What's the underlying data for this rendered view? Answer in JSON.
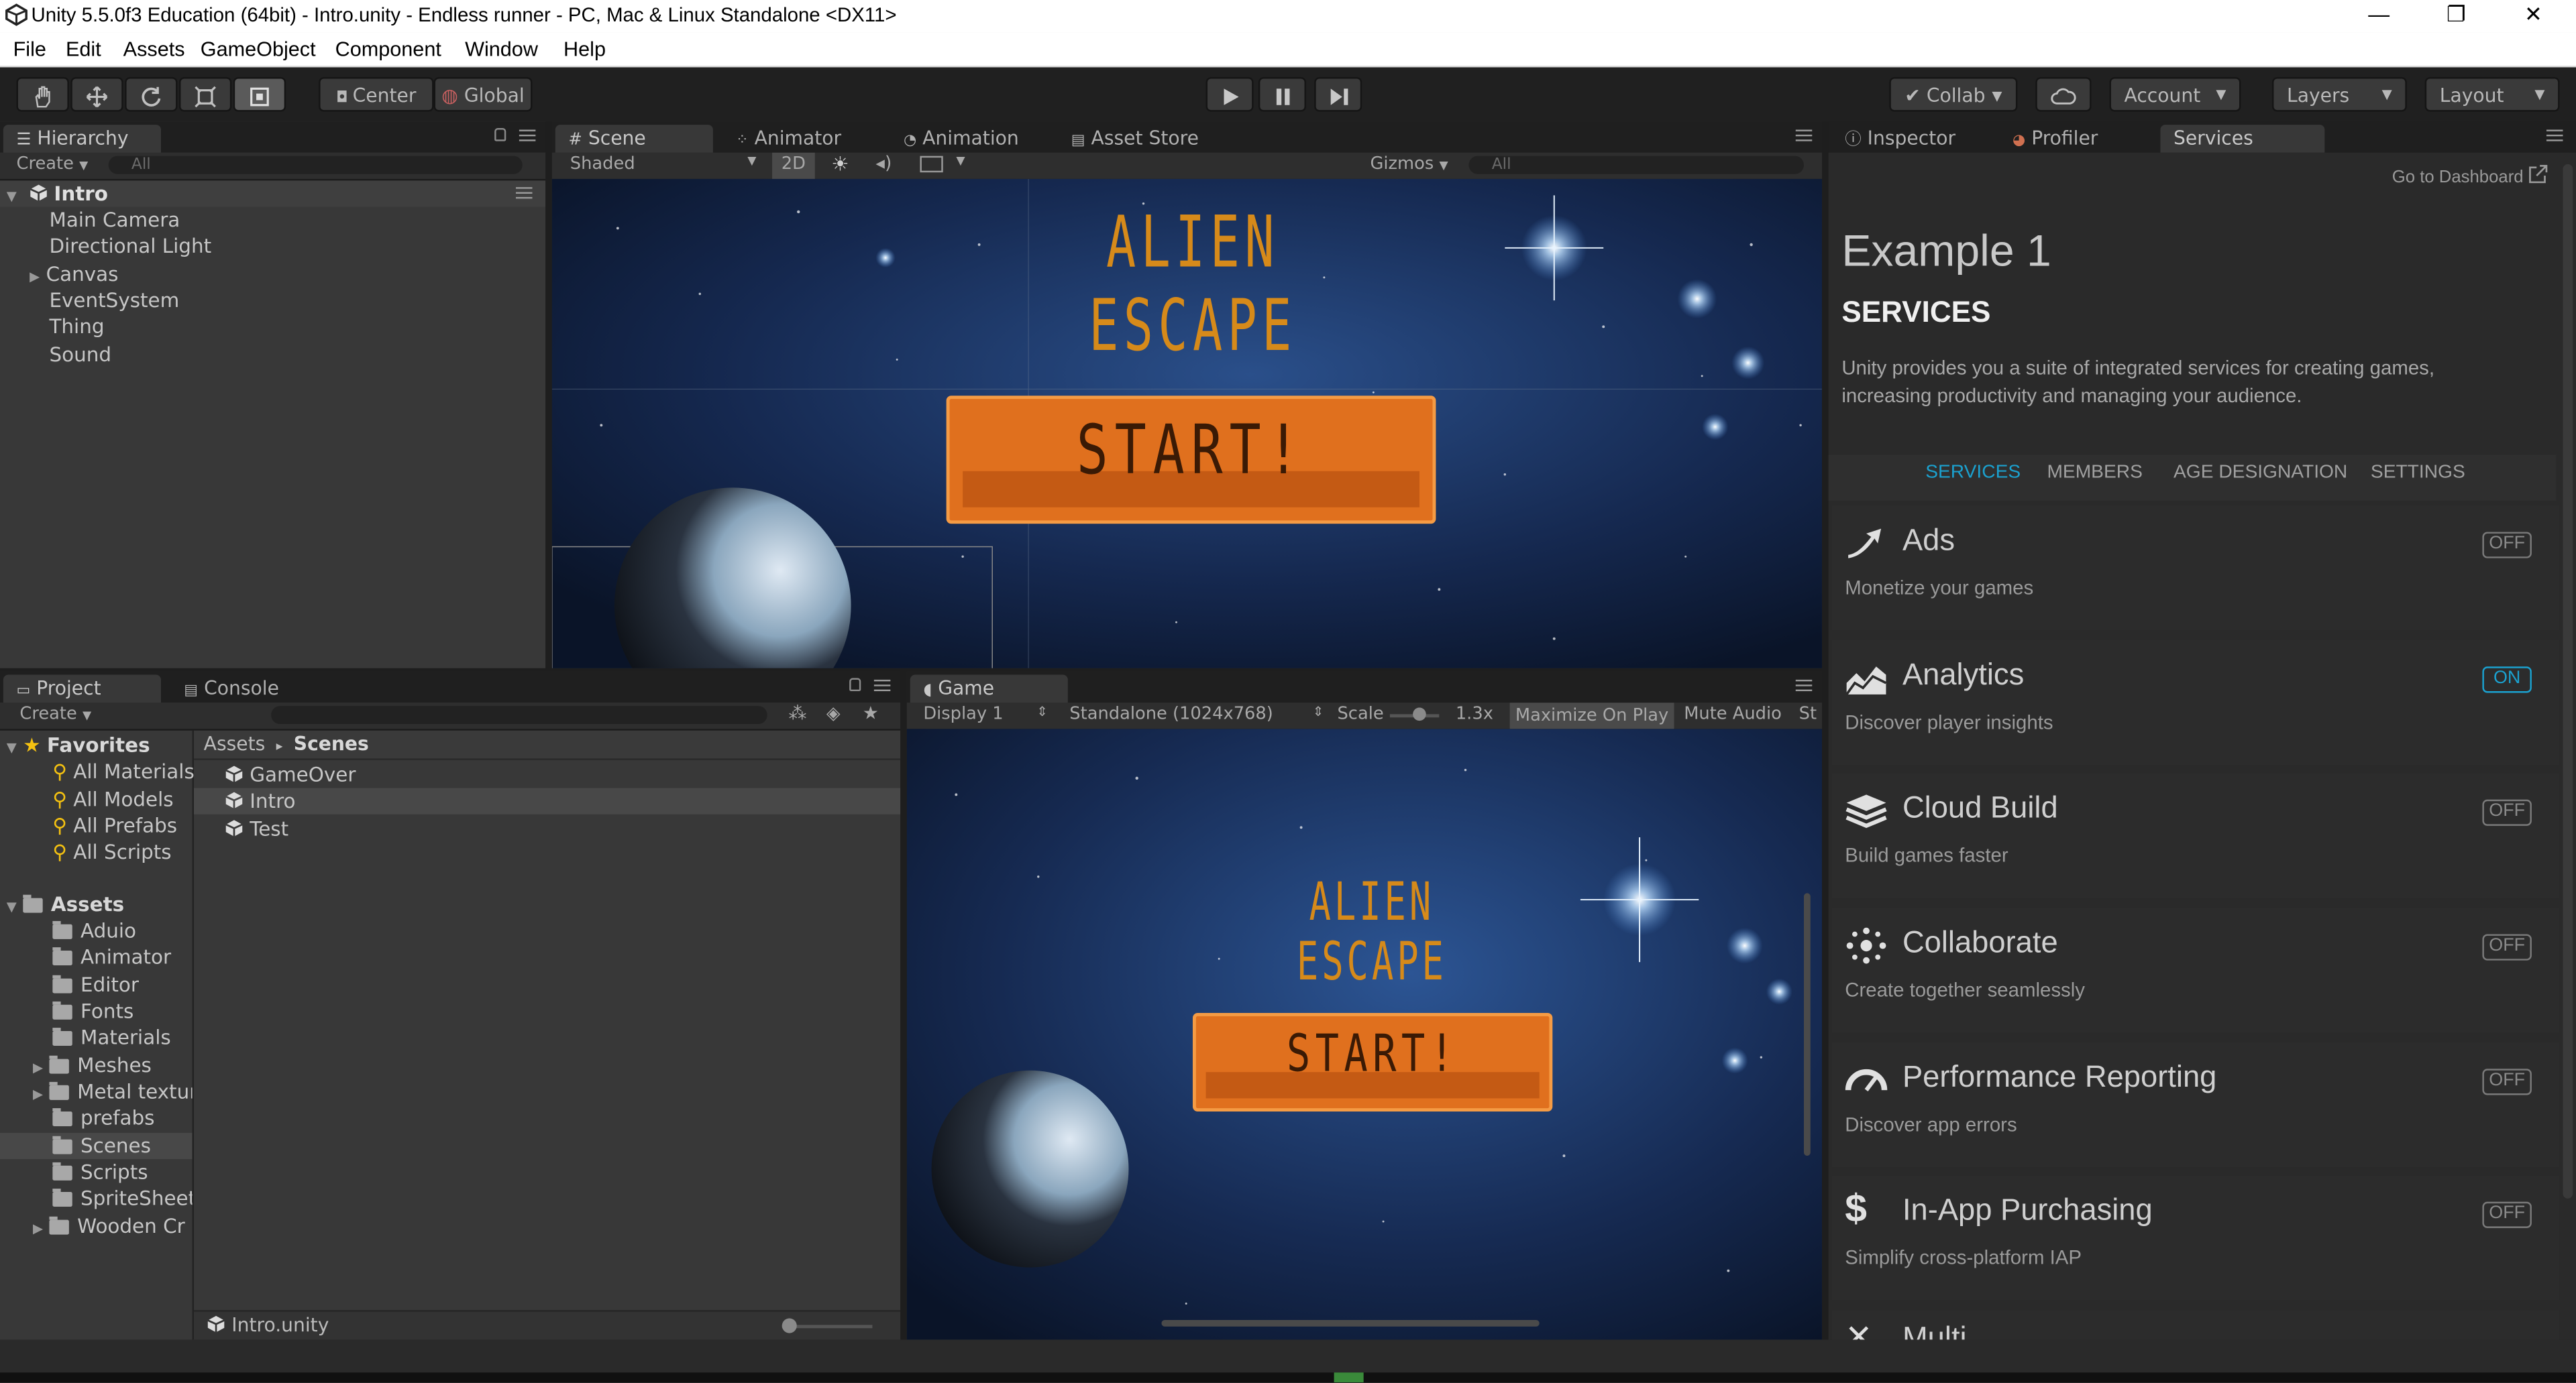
{
  "window": {
    "title": "Unity 5.5.0f3 Education (64bit) - Intro.unity - Endless runner - PC, Mac & Linux Standalone <DX11>",
    "minimize": "—",
    "restore": "❐",
    "close": "✕"
  },
  "menu": [
    "File",
    "Edit",
    "Assets",
    "GameObject",
    "Component",
    "Window",
    "Help"
  ],
  "toolbar": {
    "center_label": "Center",
    "global_label": "Global",
    "collab_label": "Collab",
    "account_label": "Account",
    "layers_label": "Layers",
    "layout_label": "Layout"
  },
  "hierarchy": {
    "tab_label": "Hierarchy",
    "create_label": "Create",
    "search_placeholder": "All",
    "scene_name": "Intro",
    "items": [
      "Main Camera",
      "Directional Light",
      "Canvas",
      "EventSystem",
      "Thing",
      "Sound"
    ]
  },
  "scene_view": {
    "tabs": [
      "Scene",
      "Animator",
      "Animation",
      "Asset Store"
    ],
    "shading": "Shaded",
    "mode_2d": "2D",
    "gizmos": "Gizmos",
    "search_placeholder": "All",
    "game_title": "ALIEN ESCAPE",
    "start_label": "START!"
  },
  "project": {
    "tabs": [
      "Project",
      "Console"
    ],
    "create_label": "Create",
    "favorites_label": "Favorites",
    "favorites": [
      "All Materials",
      "All Models",
      "All Prefabs",
      "All Scripts"
    ],
    "assets_label": "Assets",
    "folders": [
      "Aduio",
      "Animator",
      "Editor",
      "Fonts",
      "Materials",
      "Meshes",
      "Metal textur",
      "prefabs",
      "Scenes",
      "Scripts",
      "SpriteSheet",
      "Wooden Cr"
    ],
    "breadcrumb_root": "Assets",
    "breadcrumb_sep": "▸",
    "breadcrumb_current": "Scenes",
    "scene_files": [
      "GameOver",
      "Intro",
      "Test"
    ],
    "status_file": "Intro.unity"
  },
  "game_view": {
    "tab_label": "Game",
    "display": "Display 1",
    "resolution": "Standalone (1024x768)",
    "scale_label": "Scale",
    "scale_value": "1.3x",
    "maximize_label": "Maximize On Play",
    "mute_label": "Mute Audio",
    "stats_label": "St"
  },
  "services_panel": {
    "tabs": [
      "Inspector",
      "Profiler",
      "Services"
    ],
    "dashboard_link": "Go to Dashboard",
    "project_name": "Example 1",
    "heading": "SERVICES",
    "intro": "Unity provides you a suite of integrated services for creating games, increasing productivity and managing your audience.",
    "nav_tabs": [
      "SERVICES",
      "MEMBERS",
      "AGE DESIGNATION",
      "SETTINGS"
    ],
    "accent_color": "#1ba1cf",
    "services": [
      {
        "name": "Ads",
        "desc": "Monetize your games",
        "state": "OFF",
        "icon": "ads-icon"
      },
      {
        "name": "Analytics",
        "desc": "Discover player insights",
        "state": "ON",
        "icon": "analytics-icon"
      },
      {
        "name": "Cloud Build",
        "desc": "Build games faster",
        "state": "OFF",
        "icon": "cloud-build-icon"
      },
      {
        "name": "Collaborate",
        "desc": "Create together seamlessly",
        "state": "OFF",
        "icon": "collaborate-icon"
      },
      {
        "name": "Performance Reporting",
        "desc": "Discover app errors",
        "state": "OFF",
        "icon": "performance-icon"
      },
      {
        "name": "In-App Purchasing",
        "desc": "Simplify cross-platform IAP",
        "state": "OFF",
        "icon": "dollar-icon"
      }
    ],
    "partial_next": "Multi..."
  }
}
